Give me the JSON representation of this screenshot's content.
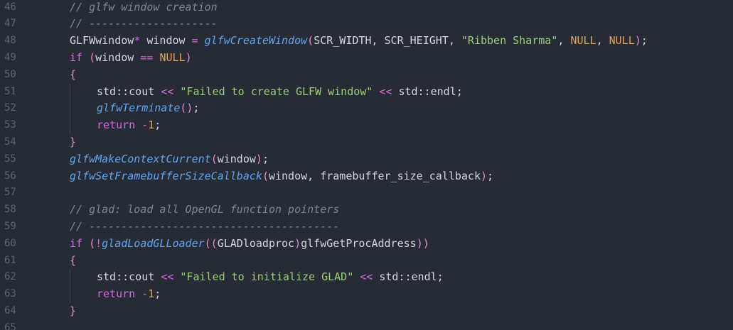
{
  "editor": {
    "lines": [
      {
        "n": "46",
        "indent": 1,
        "tokens": [
          [
            "comment",
            "// glfw window creation"
          ]
        ]
      },
      {
        "n": "47",
        "indent": 1,
        "tokens": [
          [
            "comment",
            "// --------------------"
          ]
        ]
      },
      {
        "n": "48",
        "indent": 1,
        "tokens": [
          [
            "plain",
            "GLFWwindow"
          ],
          [
            "op",
            "*"
          ],
          [
            "plain",
            " window "
          ],
          [
            "op",
            "="
          ],
          [
            "plain",
            " "
          ],
          [
            "func",
            "glfwCreateWindow"
          ],
          [
            "paren",
            "("
          ],
          [
            "plain",
            "SCR_WIDTH, SCR_HEIGHT, "
          ],
          [
            "string",
            "\"Ribben Sharma\""
          ],
          [
            "plain",
            ", "
          ],
          [
            "const",
            "NULL"
          ],
          [
            "plain",
            ", "
          ],
          [
            "const",
            "NULL"
          ],
          [
            "paren",
            ")"
          ],
          [
            "plain",
            ";"
          ]
        ]
      },
      {
        "n": "49",
        "indent": 1,
        "tokens": [
          [
            "keyword",
            "if"
          ],
          [
            "plain",
            " "
          ],
          [
            "paren",
            "("
          ],
          [
            "plain",
            "window "
          ],
          [
            "op",
            "=="
          ],
          [
            "plain",
            " "
          ],
          [
            "const",
            "NULL"
          ],
          [
            "paren",
            ")"
          ]
        ]
      },
      {
        "n": "50",
        "indent": 1,
        "tokens": [
          [
            "paren",
            "{"
          ]
        ]
      },
      {
        "n": "51",
        "indent": 2,
        "tokens": [
          [
            "plain",
            "std::cout "
          ],
          [
            "op",
            "<<"
          ],
          [
            "plain",
            " "
          ],
          [
            "string",
            "\"Failed to create GLFW window\""
          ],
          [
            "plain",
            " "
          ],
          [
            "op",
            "<<"
          ],
          [
            "plain",
            " std::endl;"
          ]
        ]
      },
      {
        "n": "52",
        "indent": 2,
        "tokens": [
          [
            "func",
            "glfwTerminate"
          ],
          [
            "paren",
            "()"
          ],
          [
            "plain",
            ";"
          ]
        ]
      },
      {
        "n": "53",
        "indent": 2,
        "tokens": [
          [
            "keyword",
            "return"
          ],
          [
            "plain",
            " "
          ],
          [
            "op",
            "-"
          ],
          [
            "number",
            "1"
          ],
          [
            "plain",
            ";"
          ]
        ]
      },
      {
        "n": "54",
        "indent": 1,
        "tokens": [
          [
            "paren",
            "}"
          ]
        ]
      },
      {
        "n": "55",
        "indent": 1,
        "tokens": [
          [
            "func",
            "glfwMakeContextCurrent"
          ],
          [
            "paren",
            "("
          ],
          [
            "plain",
            "window"
          ],
          [
            "paren",
            ")"
          ],
          [
            "plain",
            ";"
          ]
        ]
      },
      {
        "n": "56",
        "indent": 1,
        "tokens": [
          [
            "func",
            "glfwSetFramebufferSizeCallback"
          ],
          [
            "paren",
            "("
          ],
          [
            "plain",
            "window, framebuffer_size_callback"
          ],
          [
            "paren",
            ")"
          ],
          [
            "plain",
            ";"
          ]
        ]
      },
      {
        "n": "57",
        "indent": 1,
        "tokens": []
      },
      {
        "n": "58",
        "indent": 1,
        "tokens": [
          [
            "comment",
            "// glad: load all OpenGL function pointers"
          ]
        ]
      },
      {
        "n": "59",
        "indent": 1,
        "tokens": [
          [
            "comment",
            "// ---------------------------------------"
          ]
        ]
      },
      {
        "n": "60",
        "indent": 1,
        "tokens": [
          [
            "keyword",
            "if"
          ],
          [
            "plain",
            " "
          ],
          [
            "paren",
            "("
          ],
          [
            "op",
            "!"
          ],
          [
            "func",
            "gladLoadGLLoader"
          ],
          [
            "paren",
            "(("
          ],
          [
            "plain",
            "GLADloadproc"
          ],
          [
            "paren",
            ")"
          ],
          [
            "plain",
            "glfwGetProcAddress"
          ],
          [
            "paren",
            "))"
          ]
        ]
      },
      {
        "n": "61",
        "indent": 1,
        "tokens": [
          [
            "paren",
            "{"
          ]
        ]
      },
      {
        "n": "62",
        "indent": 2,
        "tokens": [
          [
            "plain",
            "std::cout "
          ],
          [
            "op",
            "<<"
          ],
          [
            "plain",
            " "
          ],
          [
            "string",
            "\"Failed to initialize GLAD\""
          ],
          [
            "plain",
            " "
          ],
          [
            "op",
            "<<"
          ],
          [
            "plain",
            " std::endl;"
          ]
        ]
      },
      {
        "n": "63",
        "indent": 2,
        "tokens": [
          [
            "keyword",
            "return"
          ],
          [
            "plain",
            " "
          ],
          [
            "op",
            "-"
          ],
          [
            "number",
            "1"
          ],
          [
            "plain",
            ";"
          ]
        ]
      },
      {
        "n": "64",
        "indent": 1,
        "tokens": [
          [
            "paren",
            "}"
          ]
        ]
      },
      {
        "n": "65",
        "indent": 1,
        "tokens": []
      }
    ]
  }
}
